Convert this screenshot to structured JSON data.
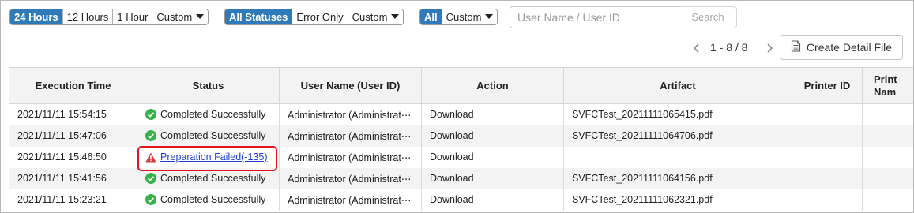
{
  "filters": {
    "time": {
      "options": [
        "24 Hours",
        "12 Hours",
        "1 Hour"
      ],
      "custom_label": "Custom",
      "active_index": 0
    },
    "status": {
      "options": [
        "All Statuses",
        "Error Only"
      ],
      "custom_label": "Custom",
      "active_index": 0
    },
    "type": {
      "options": [
        "All"
      ],
      "custom_label": "Custom",
      "active_index": 0
    }
  },
  "search": {
    "placeholder": "User Name / User ID",
    "value": "",
    "button_label": "Search"
  },
  "pager": {
    "text": "1 - 8 / 8"
  },
  "create_button": {
    "label": "Create Detail File"
  },
  "table": {
    "columns": [
      "Execution Time",
      "Status",
      "User Name (User ID)",
      "Action",
      "Artifact",
      "Printer ID",
      "Printer Name"
    ],
    "last_column_visible": [
      "Print",
      "Nam"
    ],
    "rows": [
      {
        "time": "2021/11/11 15:54:15",
        "status": "Completed Successfully",
        "status_type": "success",
        "user": "Administrator (Administrat⋯",
        "action": "Download",
        "artifact": "SVFCTest_20211111065415.pdf",
        "printer_id": "",
        "printer_name": ""
      },
      {
        "time": "2021/11/11 15:47:06",
        "status": "Completed Successfully",
        "status_type": "success",
        "user": "Administrator (Administrat⋯",
        "action": "Download",
        "artifact": "SVFCTest_20211111064706.pdf",
        "printer_id": "",
        "printer_name": ""
      },
      {
        "time": "2021/11/11 15:46:50",
        "status": "Preparation Failed(-135)",
        "status_type": "error",
        "user": "Administrator (Administrat⋯",
        "action": "Download",
        "artifact": "",
        "printer_id": "",
        "printer_name": ""
      },
      {
        "time": "2021/11/11 15:41:56",
        "status": "Completed Successfully",
        "status_type": "success",
        "user": "Administrator (Administrat⋯",
        "action": "Download",
        "artifact": "SVFCTest_20211111064156.pdf",
        "printer_id": "",
        "printer_name": ""
      },
      {
        "time": "2021/11/11 15:23:21",
        "status": "Completed Successfully",
        "status_type": "success",
        "user": "Administrator (Administrat⋯",
        "action": "Download",
        "artifact": "SVFCTest_20211111062321.pdf",
        "printer_id": "",
        "printer_name": ""
      }
    ]
  },
  "colors": {
    "accent": "#2f7ab9",
    "success": "#35b34a",
    "error": "#d9383e",
    "highlight": "#e0141d",
    "link": "#1f3fd1"
  },
  "icons": {
    "prev": "chevron-left-icon",
    "next": "chevron-right-icon",
    "file": "document-icon",
    "success": "check-circle-icon",
    "error": "warning-triangle-icon",
    "dropdown": "caret-down-icon"
  }
}
